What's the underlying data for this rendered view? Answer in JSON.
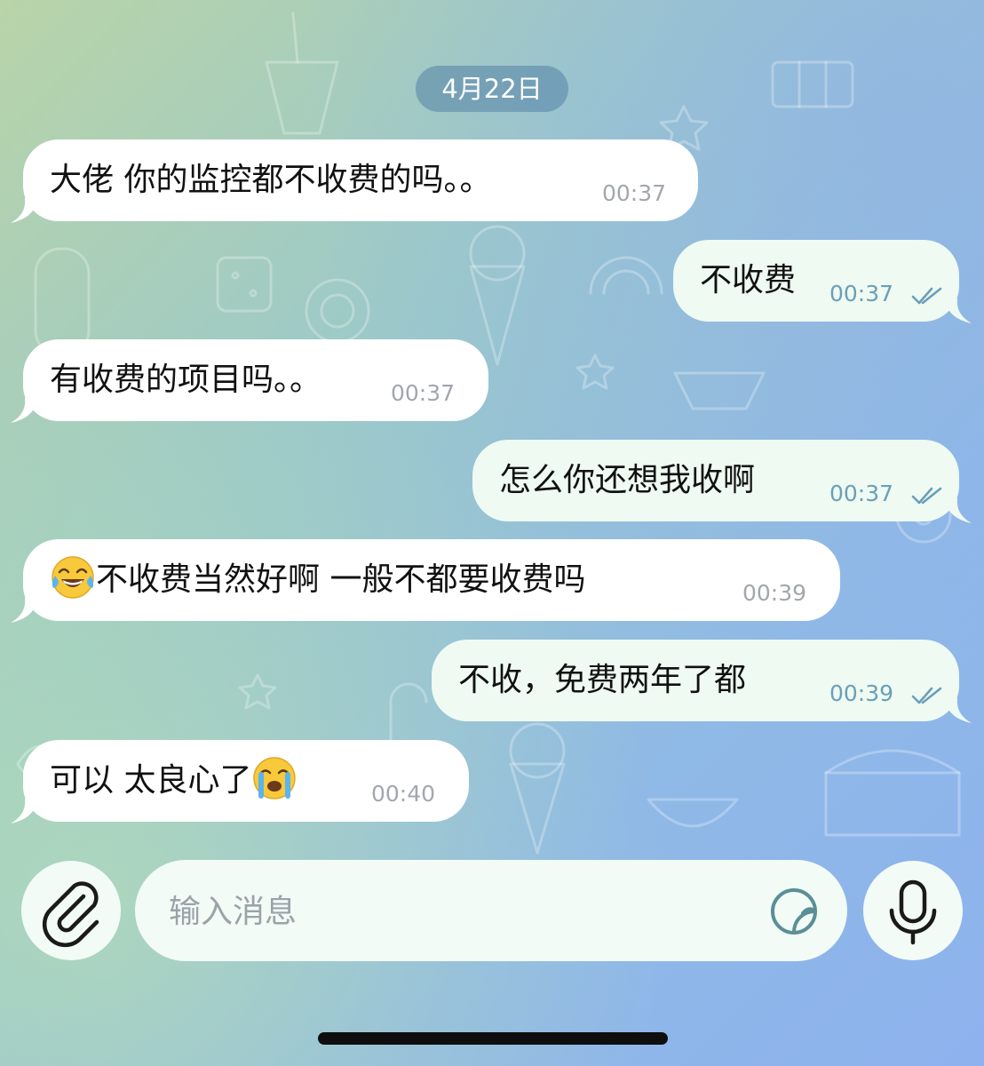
{
  "date_separator": "4月22日",
  "messages": [
    {
      "direction": "in",
      "text": "大佬 你的监控都不收费的吗。。",
      "time": "00:37"
    },
    {
      "direction": "out",
      "text": "不收费",
      "time": "00:37",
      "status": "read"
    },
    {
      "direction": "in",
      "text": "有收费的项目吗。。",
      "time": "00:37"
    },
    {
      "direction": "out",
      "text": "怎么你还想我收啊",
      "time": "00:37",
      "status": "read"
    },
    {
      "direction": "in",
      "emoji_prefix": "face-with-tears-of-joy",
      "text": "不收费当然好啊  一般不都要收费吗",
      "time": "00:39"
    },
    {
      "direction": "out",
      "text": "不收，免费两年了都",
      "time": "00:39",
      "status": "read"
    },
    {
      "direction": "in",
      "text": "可以 太良心了",
      "emoji_suffix": "loudly-crying-face",
      "time": "00:40"
    }
  ],
  "composer": {
    "placeholder": "输入消息",
    "value": "",
    "attach_icon": "paperclip-icon",
    "sticker_icon": "sticker-icon",
    "mic_icon": "microphone-icon"
  },
  "colors": {
    "incoming_bubble": "#ffffff",
    "outgoing_bubble": "#eefaf2",
    "outgoing_time": "#6b9fb8",
    "incoming_time": "#a2a7ad",
    "date_pill": "#5482a6",
    "accent_icon": "#5a8f96"
  }
}
